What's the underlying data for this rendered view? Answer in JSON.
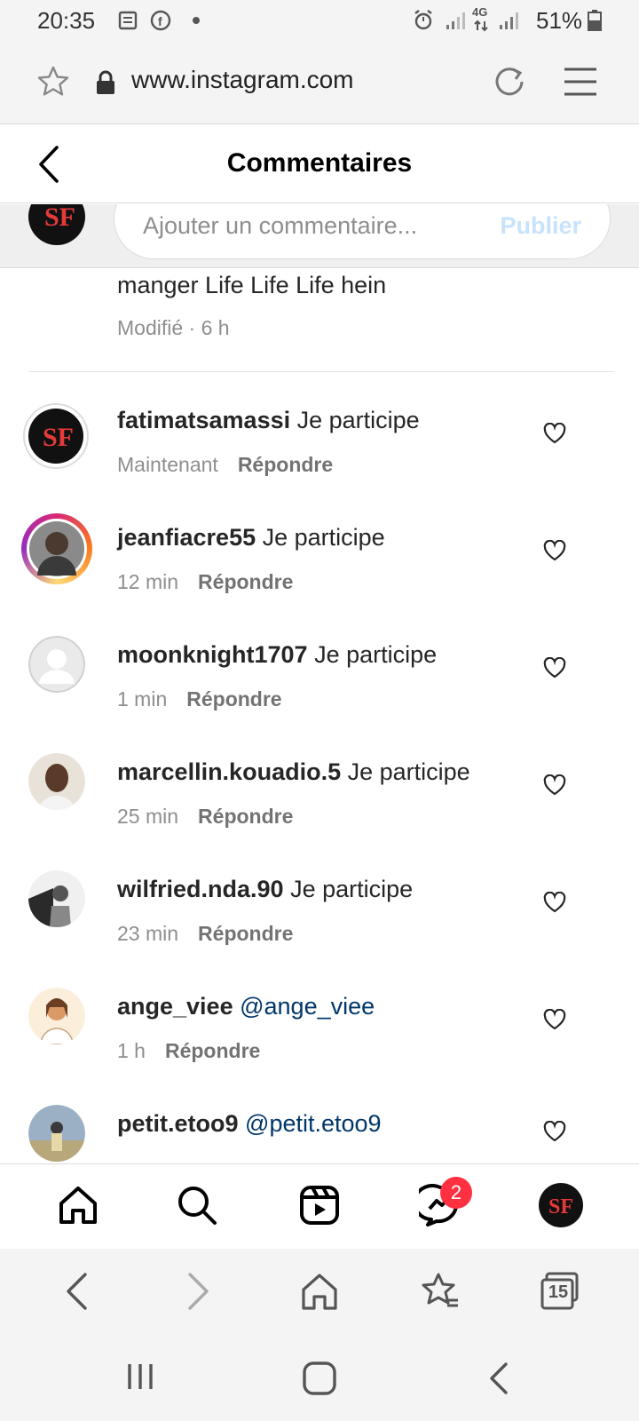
{
  "status_bar": {
    "time": "20:35",
    "network": "4G",
    "battery": "51%"
  },
  "browser": {
    "url": "www.instagram.com",
    "tab_count": "15"
  },
  "header": {
    "title": "Commentaires"
  },
  "comment_input": {
    "placeholder": "Ajouter un commentaire...",
    "publish_label": "Publier"
  },
  "previous_comment": {
    "text": "manger Life Life Life hein",
    "meta": "Modifié · 6 h"
  },
  "reply_label": "Répondre",
  "comments": [
    {
      "user": "fatimatsamassi",
      "text": "Je participe",
      "time": "Maintenant"
    },
    {
      "user": "jeanfiacre55",
      "text": "Je participe",
      "time": "12 min"
    },
    {
      "user": "moonknight1707",
      "text": "Je participe",
      "time": "1 min"
    },
    {
      "user": "marcellin.kouadio.5",
      "text": "Je participe",
      "time": "25 min"
    },
    {
      "user": "wilfried.nda.90",
      "text": "Je participe",
      "time": "23 min"
    },
    {
      "user": "ange_viee",
      "mention": "@ange_viee",
      "time": "1 h"
    },
    {
      "user": "petit.etoo9",
      "mention": "@petit.etoo9"
    }
  ],
  "nav": {
    "messenger_badge": "2"
  },
  "colors": {
    "mention": "#00376b",
    "badge": "#ff3040",
    "publish_disabled": "#c7e3fb"
  }
}
